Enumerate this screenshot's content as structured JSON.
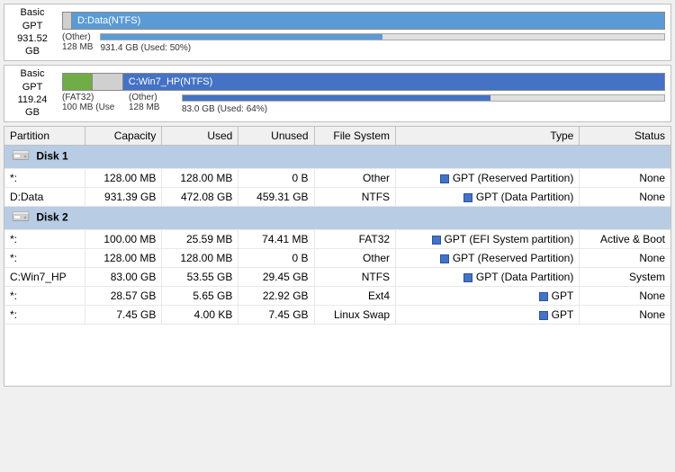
{
  "disk1": {
    "label_line1": "Basic GPT",
    "label_line2": "931.52 GB",
    "partitions_display": [
      {
        "label": "(Other)",
        "sub": "128 MB",
        "type": "other",
        "width_pct": 1
      },
      {
        "label": "D:Data(NTFS)",
        "sub": "931.4 GB (Used: 50%)",
        "type": "data",
        "width_pct": 99
      }
    ],
    "used_pct": 50
  },
  "disk2": {
    "label_line1": "Basic GPT",
    "label_line2": "119.24 GB",
    "partitions_display": [
      {
        "label": "(FAT32)",
        "sub": "100 MB (Use",
        "type": "fat32",
        "width_pct": 5
      },
      {
        "label": "(Other)",
        "sub": "128 MB",
        "type": "other",
        "width_pct": 5
      },
      {
        "label": "C:Win7_HP(NTFS)",
        "sub": "83.0 GB (Used: 64%)",
        "type": "winc",
        "width_pct": 90
      }
    ],
    "used_pct": 64
  },
  "table": {
    "columns": [
      "Partition",
      "Capacity",
      "Used",
      "Unused",
      "File System",
      "Type",
      "Status"
    ],
    "disk1_label": "Disk 1",
    "disk2_label": "Disk 2",
    "disk1_rows": [
      {
        "partition": "*:",
        "capacity": "128.00 MB",
        "used": "128.00 MB",
        "unused": "0 B",
        "fs": "Other",
        "type": "GPT (Reserved Partition)",
        "status": "None"
      },
      {
        "partition": "D:Data",
        "capacity": "931.39 GB",
        "used": "472.08 GB",
        "unused": "459.31 GB",
        "fs": "NTFS",
        "type": "GPT (Data Partition)",
        "status": "None"
      }
    ],
    "disk2_rows": [
      {
        "partition": "*:",
        "capacity": "100.00 MB",
        "used": "25.59 MB",
        "unused": "74.41 MB",
        "fs": "FAT32",
        "type": "GPT (EFI System partition)",
        "status": "Active & Boot"
      },
      {
        "partition": "*:",
        "capacity": "128.00 MB",
        "used": "128.00 MB",
        "unused": "0 B",
        "fs": "Other",
        "type": "GPT (Reserved Partition)",
        "status": "None"
      },
      {
        "partition": "C:Win7_HP",
        "capacity": "83.00 GB",
        "used": "53.55 GB",
        "unused": "29.45 GB",
        "fs": "NTFS",
        "type": "GPT (Data Partition)",
        "status": "System"
      },
      {
        "partition": "*:",
        "capacity": "28.57 GB",
        "used": "5.65 GB",
        "unused": "22.92 GB",
        "fs": "Ext4",
        "type": "GPT",
        "status": "None"
      },
      {
        "partition": "*:",
        "capacity": "7.45 GB",
        "used": "4.00 KB",
        "unused": "7.45 GB",
        "fs": "Linux Swap",
        "type": "GPT",
        "status": "None"
      }
    ]
  }
}
